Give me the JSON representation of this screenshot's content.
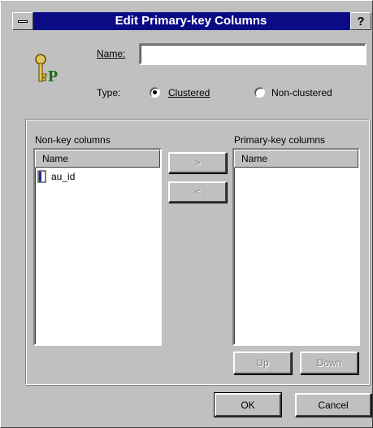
{
  "dialog": {
    "title": "Edit Primary-key Columns",
    "help_label": "?"
  },
  "icon": {
    "letter": "P"
  },
  "name": {
    "label": "Name:",
    "value": ""
  },
  "type": {
    "label": "Type:",
    "options": [
      {
        "label": "Clustered",
        "selected": true
      },
      {
        "label": "Non-clustered",
        "selected": false
      }
    ]
  },
  "nonkey": {
    "label": "Non-key columns",
    "header": "Name",
    "items": [
      "au_id"
    ]
  },
  "pk": {
    "label": "Primary-key columns",
    "header": "Name",
    "items": []
  },
  "transfer": {
    "add_label": ">",
    "remove_label": "<"
  },
  "order": {
    "up_label": "Up",
    "down_label": "Down"
  },
  "footer": {
    "ok_label": "OK",
    "cancel_label": "Cancel"
  }
}
